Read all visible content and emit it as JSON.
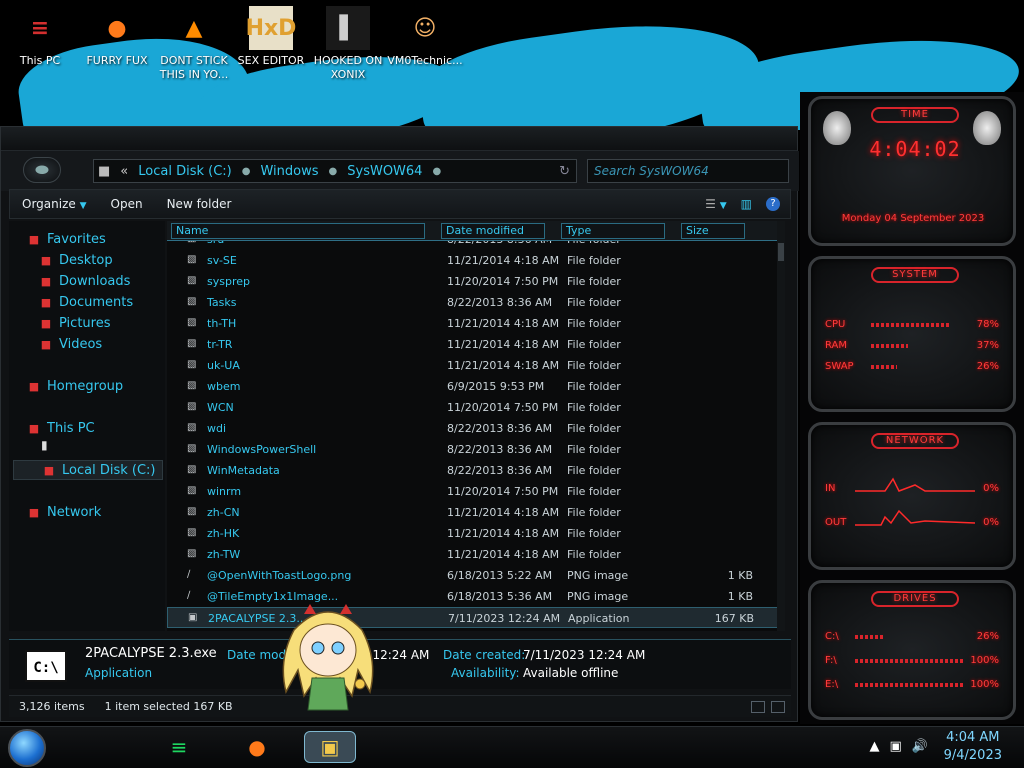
{
  "desktop": {
    "icons": [
      {
        "label": "This PC",
        "glyph": "≡",
        "icon": "this-pc-icon"
      },
      {
        "label": "FURRY FUX",
        "glyph": "●",
        "icon": "firefox-icon"
      },
      {
        "label": "DONT STICK THIS IN YO...",
        "glyph": "▲",
        "icon": "vlc-cone-icon"
      },
      {
        "label": "SEX EDITOR",
        "glyph": "HxD",
        "icon": "hex-editor-icon"
      },
      {
        "label": "HOOKED ON XONIX",
        "glyph": "▌",
        "icon": "xonix-game-icon"
      },
      {
        "label": "VM0Technic...",
        "glyph": "☺",
        "icon": "technician-icon"
      }
    ]
  },
  "explorer": {
    "breadcrumb": [
      "Local Disk (C:)",
      "Windows",
      "SysWOW64"
    ],
    "back_glyph": "«",
    "search_placeholder": "Search SysWOW64",
    "toolbar": {
      "organize": "Organize",
      "open": "Open",
      "new_folder": "New folder"
    },
    "sidebar": [
      {
        "label": "Favorites",
        "icon": "favorites-star-icon",
        "indent": 0
      },
      {
        "label": "Desktop",
        "icon": "desktop-folder-icon",
        "indent": 1
      },
      {
        "label": "Downloads",
        "icon": "downloads-folder-icon",
        "indent": 1
      },
      {
        "label": "Documents",
        "icon": "documents-folder-icon",
        "indent": 1
      },
      {
        "label": "Pictures",
        "icon": "pictures-folder-icon",
        "indent": 1
      },
      {
        "label": "Videos",
        "icon": "videos-folder-icon",
        "indent": 1
      },
      {
        "label": "Homegroup",
        "icon": "homegroup-icon",
        "indent": 0
      },
      {
        "label": "This PC",
        "icon": "this-pc-icon",
        "indent": 0
      },
      {
        "label": "Local Disk (C:)",
        "icon": "local-disk-icon",
        "indent": 1,
        "selected": true
      },
      {
        "label": "Network",
        "icon": "network-icon",
        "indent": 0
      }
    ],
    "columns": {
      "name": "Name",
      "date": "Date modified",
      "type": "Type",
      "size": "Size"
    },
    "partial_row": {
      "name": "sru",
      "date": "8/22/2013 8:36 AM",
      "type": "File folder"
    },
    "rows": [
      {
        "name": "sv-SE",
        "date": "11/21/2014 4:18 AM",
        "type": "File folder",
        "size": ""
      },
      {
        "name": "sysprep",
        "date": "11/20/2014 7:50 PM",
        "type": "File folder",
        "size": ""
      },
      {
        "name": "Tasks",
        "date": "8/22/2013 8:36 AM",
        "type": "File folder",
        "size": ""
      },
      {
        "name": "th-TH",
        "date": "11/21/2014 4:18 AM",
        "type": "File folder",
        "size": ""
      },
      {
        "name": "tr-TR",
        "date": "11/21/2014 4:18 AM",
        "type": "File folder",
        "size": ""
      },
      {
        "name": "uk-UA",
        "date": "11/21/2014 4:18 AM",
        "type": "File folder",
        "size": ""
      },
      {
        "name": "wbem",
        "date": "6/9/2015 9:53 PM",
        "type": "File folder",
        "size": ""
      },
      {
        "name": "WCN",
        "date": "11/20/2014 7:50 PM",
        "type": "File folder",
        "size": ""
      },
      {
        "name": "wdi",
        "date": "8/22/2013 8:36 AM",
        "type": "File folder",
        "size": ""
      },
      {
        "name": "WindowsPowerShell",
        "date": "8/22/2013 8:36 AM",
        "type": "File folder",
        "size": ""
      },
      {
        "name": "WinMetadata",
        "date": "8/22/2013 8:36 AM",
        "type": "File folder",
        "size": ""
      },
      {
        "name": "winrm",
        "date": "11/20/2014 7:50 PM",
        "type": "File folder",
        "size": ""
      },
      {
        "name": "zh-CN",
        "date": "11/21/2014 4:18 AM",
        "type": "File folder",
        "size": ""
      },
      {
        "name": "zh-HK",
        "date": "11/21/2014 4:18 AM",
        "type": "File folder",
        "size": ""
      },
      {
        "name": "zh-TW",
        "date": "11/21/2014 4:18 AM",
        "type": "File folder",
        "size": ""
      },
      {
        "name": "@OpenWithToastLogo.png",
        "date": "6/18/2013 5:22 AM",
        "type": "PNG image",
        "size": "1 KB"
      },
      {
        "name": "@TileEmpty1x1Image...",
        "date": "6/18/2013 5:36 AM",
        "type": "PNG image",
        "size": "1 KB"
      },
      {
        "name": "2PACALYPSE 2.3...",
        "date": "7/11/2023 12:24 AM",
        "type": "Application",
        "size": "167 KB",
        "selected": true
      }
    ],
    "details": {
      "icon_text": "C:\\",
      "filename": "2PACALYPSE 2.3.exe",
      "filetype": "Application",
      "modified_label": "Date modifi",
      "modified_value": "3 12:24 AM",
      "created_label": "Date created:",
      "created_value": "7/11/2023 12:24 AM",
      "availability_label": "Availability:",
      "availability_value": "Available offline"
    },
    "status": {
      "items": "3,126 items",
      "selected": "1 item selected  167 KB"
    }
  },
  "widgets": {
    "time": {
      "title": "TIME",
      "clock": "4:04:02",
      "date": "Monday 04 September 2023"
    },
    "system": {
      "title": "SYSTEM",
      "metrics": [
        {
          "label": "CPU",
          "value": "78%",
          "level": 0.78
        },
        {
          "label": "RAM",
          "value": "37%",
          "level": 0.37
        },
        {
          "label": "SWAP",
          "value": "26%",
          "level": 0.26
        }
      ]
    },
    "network": {
      "title": "NETWORK",
      "in_label": "IN",
      "in_value": "0%",
      "out_label": "OUT",
      "out_value": "0%"
    },
    "drives": {
      "title": "DRIVES",
      "items": [
        {
          "label": "C:\\",
          "value": "26%",
          "level": 0.26
        },
        {
          "label": "F:\\",
          "value": "100%",
          "level": 1.0
        },
        {
          "label": "E:\\",
          "value": "100%",
          "level": 1.0
        }
      ]
    }
  },
  "taskbar": {
    "apps": [
      {
        "name": "spotify-icon",
        "glyph": "≡",
        "color": "#1ed760"
      },
      {
        "name": "firefox-taskbar-icon",
        "glyph": "●",
        "color": "#ff7a1a"
      },
      {
        "name": "file-explorer-icon",
        "glyph": "▣",
        "color": "#f2c94c"
      }
    ],
    "time": "4:04 AM",
    "date": "9/4/2023"
  },
  "colors": {
    "accent": "#36c8ef",
    "alert": "#ff3b3b",
    "wallpaper_splash": "#1aa7d6"
  }
}
